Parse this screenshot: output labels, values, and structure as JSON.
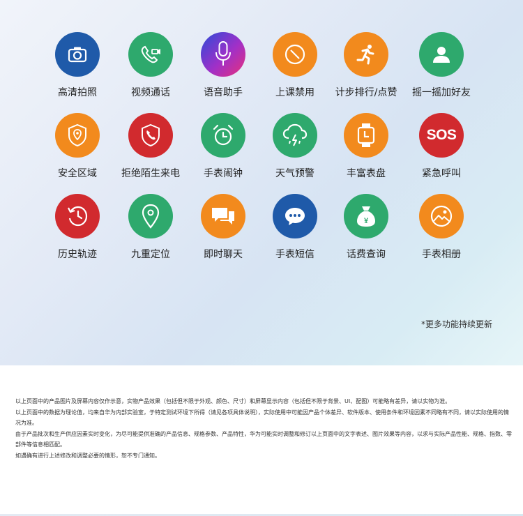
{
  "colors": {
    "blue": "#1f5aa9",
    "green": "#2ea96d",
    "orange": "#f28a1d",
    "red": "#d12a2e",
    "purple_gradient": [
      "#2b4bd8",
      "#a030c8",
      "#e8307a"
    ]
  },
  "features": [
    {
      "label": "高清拍照",
      "icon": "camera-icon",
      "color": "#1f5aa9"
    },
    {
      "label": "视频通话",
      "icon": "video-call-icon",
      "color": "#2ea96d"
    },
    {
      "label": "语音助手",
      "icon": "microphone-icon",
      "color": "gradient"
    },
    {
      "label": "上课禁用",
      "icon": "prohibited-icon",
      "color": "#f28a1d"
    },
    {
      "label": "计步排行/点赞",
      "icon": "running-person-icon",
      "color": "#f28a1d"
    },
    {
      "label": "摇一摇加好友",
      "icon": "person-icon",
      "color": "#2ea96d"
    },
    {
      "label": "安全区域",
      "icon": "safe-zone-shield-icon",
      "color": "#f28a1d"
    },
    {
      "label": "拒绝陌生来电",
      "icon": "shield-phone-icon",
      "color": "#d12a2e"
    },
    {
      "label": "手表闹钟",
      "icon": "alarm-clock-icon",
      "color": "#2ea96d"
    },
    {
      "label": "天气预警",
      "icon": "weather-cloud-icon",
      "color": "#2ea96d"
    },
    {
      "label": "丰富表盘",
      "icon": "watch-face-icon",
      "color": "#f28a1d"
    },
    {
      "label": "紧急呼叫",
      "icon": "sos-icon",
      "color": "#d12a2e"
    },
    {
      "label": "历史轨迹",
      "icon": "history-clock-icon",
      "color": "#d12a2e"
    },
    {
      "label": "九重定位",
      "icon": "location-pin-icon",
      "color": "#2ea96d"
    },
    {
      "label": "即时聊天",
      "icon": "chat-bubbles-icon",
      "color": "#f28a1d"
    },
    {
      "label": "手表短信",
      "icon": "message-bubble-icon",
      "color": "#1f5aa9"
    },
    {
      "label": "话费查询",
      "icon": "money-bag-icon",
      "color": "#2ea96d"
    },
    {
      "label": "手表相册",
      "icon": "photo-album-icon",
      "color": "#f28a1d"
    }
  ],
  "sos_text": "SOS",
  "currency_symbol": "¥",
  "note": "*更多功能持续更新",
  "disclaimer": [
    "以上页面中的产品图片及屏幕内容仅作示意，实物产品效果（包括但不限于外观、颜色、尺寸）和屏幕显示内容（包括但不限于背景、UI、配图）可能略有差异，请以实物为准。",
    "以上页面中的数据为理论值，均来自华为内部实验室，于特定测试环境下所得（请见各项具体说明），实际使用中可能因产品个体差异、软件版本、使用条件和环境因素不同略有不同，请以实际使用的情况为准。",
    "由于产品批次和生产供应因素实时变化，为尽可能提供准确的产品信息、规格参数、产品特性，华为可能实时调整和修订以上页面中的文字表述、图片效果等内容，以求与实际产品性能、规格、指数、零部件等信息相匹配。",
    "如遇确有进行上述修改和调整必要的情形，恕不专门通知。"
  ]
}
